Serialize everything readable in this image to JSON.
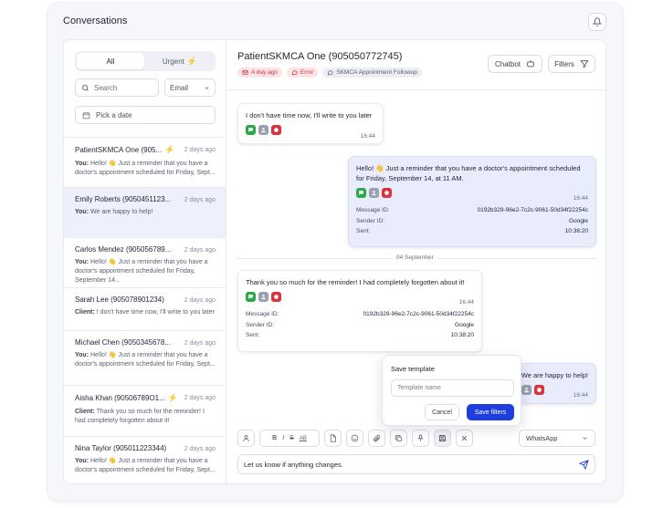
{
  "app": {
    "title": "Conversations"
  },
  "sidebar": {
    "tabs": [
      {
        "label": "All",
        "active": true
      },
      {
        "label": "Urgent",
        "active": false
      }
    ],
    "search_placeholder": "Search",
    "channel_select": "Email",
    "date_placeholder": "Pick a date",
    "conversations": [
      {
        "name": "PatientSKMCA One (905...",
        "urgent": true,
        "date": "2 days ago",
        "prefix": "You:",
        "preview": "Hello! 👋 Just a reminder that you have a doctor's appointment scheduled for Friday, Sept...",
        "selected": false
      },
      {
        "name": "Emily Roberts (9050451123...",
        "urgent": false,
        "date": "2 days ago",
        "prefix": "You:",
        "preview": "We are happy to help!",
        "selected": true
      },
      {
        "name": "Carlos Mendez (905056789...",
        "urgent": false,
        "date": "2 days ago",
        "prefix": "You:",
        "preview": "Hello! 👋 Just a reminder that you have a doctor's appointment scheduled for Friday, September 14...",
        "selected": false
      },
      {
        "name": "Sarah Lee (905078901234)",
        "urgent": false,
        "date": "2 days ago",
        "prefix": "Client:",
        "preview": "I don't have time now, I'll write to you later",
        "selected": false
      },
      {
        "name": "Michael Chen (9050345678...",
        "urgent": false,
        "date": "2 days ago",
        "prefix": "You:",
        "preview": "Hello! 👋 Just a reminder that you have a doctor's appointment scheduled for Friday, Sept...",
        "selected": false
      },
      {
        "name": "Aisha Khan (90506789O1...",
        "urgent": true,
        "date": "2 days ago",
        "prefix": "Client:",
        "preview": "Thank you so much for the reminder! I had completely forgotten about it!",
        "selected": false
      },
      {
        "name": "Nina Taylor (905011223344)",
        "urgent": false,
        "date": "2 days ago",
        "prefix": "You:",
        "preview": "Hello! 👋 Just a reminder that you have a doctor's appointment scheduled for Friday, Sept...",
        "selected": false
      }
    ]
  },
  "chat": {
    "title": "PatientSKMCA One (905050772745)",
    "chips": {
      "date": "A day ago",
      "error": "Error",
      "tag": "SKMCA Appointment Followup"
    },
    "chatbot_label": "Chatbot",
    "filters_label": "Filters",
    "messages": {
      "m1": {
        "text": "I don't have time now, I'll write to you later",
        "time": "16:44"
      },
      "m2": {
        "text": "Hello! 👋 Just a reminder that you have a doctor's appointment scheduled for Friday, September 14, at 11 AM.",
        "time": "16:44",
        "message_id_label": "Message ID:",
        "message_id": "0192b329-96e2-7c2c-9061-50d34f22254c",
        "sender_id_label": "Sender ID:",
        "sender_id": "Google",
        "sent_label": "Sent:",
        "sent": "10:38:20"
      },
      "m3": {
        "text": "Thank you so much for the reminder! I had completely forgotten about it!",
        "time": "16:44",
        "message_id_label": "Message ID:",
        "message_id": "0192b329-96e2-7c2c-9061-50d34f22254c",
        "sender_id_label": "Sender ID:",
        "sender_id": "Google",
        "sent_label": "Sent:",
        "sent": "10:38:20"
      },
      "m4": {
        "text": "We are happy to help!",
        "time": "16:44"
      }
    },
    "day_separator": "04 September",
    "toolbar": {
      "bold": "B",
      "italic": "I",
      "strike": "S",
      "aa": "AB"
    },
    "channel": "WhatsApp",
    "composer_text": "Let us know if anything changes."
  },
  "save_template": {
    "title": "Save template",
    "placeholder": "Template name",
    "cancel": "Cancel",
    "save": "Save filters"
  },
  "colors": {
    "primary": "#1f3ee0",
    "urgent": "#e5313b",
    "whatsapp": "#2aa84a"
  }
}
